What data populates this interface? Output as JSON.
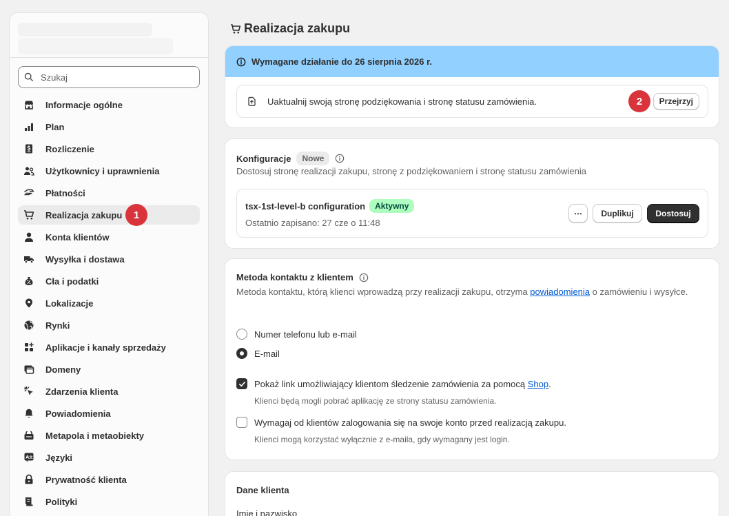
{
  "sidebar": {
    "search_placeholder": "Szukaj",
    "items": [
      {
        "label": "Informacje ogólne",
        "icon": "store-icon"
      },
      {
        "label": "Plan",
        "icon": "plan-icon"
      },
      {
        "label": "Rozliczenie",
        "icon": "billing-icon"
      },
      {
        "label": "Użytkownicy i uprawnienia",
        "icon": "users-icon"
      },
      {
        "label": "Płatności",
        "icon": "payments-icon"
      },
      {
        "label": "Realizacja zakupu",
        "icon": "cart-icon",
        "active": true,
        "marker": "1"
      },
      {
        "label": "Konta klientów",
        "icon": "person-icon"
      },
      {
        "label": "Wysyłka i dostawa",
        "icon": "truck-icon"
      },
      {
        "label": "Cła i podatki",
        "icon": "tax-icon"
      },
      {
        "label": "Lokalizacje",
        "icon": "location-icon"
      },
      {
        "label": "Rynki",
        "icon": "globe-icon"
      },
      {
        "label": "Aplikacje i kanały sprzedaży",
        "icon": "apps-icon"
      },
      {
        "label": "Domeny",
        "icon": "domain-icon"
      },
      {
        "label": "Zdarzenia klienta",
        "icon": "cursor-icon"
      },
      {
        "label": "Powiadomienia",
        "icon": "bell-icon"
      },
      {
        "label": "Metapola i metaobiekty",
        "icon": "metafields-icon"
      },
      {
        "label": "Języki",
        "icon": "language-icon"
      },
      {
        "label": "Prywatność klienta",
        "icon": "lock-icon"
      },
      {
        "label": "Polityki",
        "icon": "policy-icon"
      }
    ]
  },
  "page": {
    "title": "Realizacja zakupu"
  },
  "banner": {
    "text": "Wymagane działanie do 26 sierpnia 2026 r.",
    "update_text": "Uaktualnij swoją stronę podziękowania i stronę statusu zamówienia.",
    "review_label": "Przejrzyj",
    "marker": "2"
  },
  "configs": {
    "title": "Konfiguracje",
    "badge": "Nowe",
    "subtitle": "Dostosuj stronę realizacji zakupu, stronę z podziękowaniem i stronę statusu zamówienia",
    "item_name": "tsx-1st-level-b configuration",
    "item_status": "Aktywny",
    "item_saved": "Ostatnio zapisano: 27 cze o 11:48",
    "more_label": "⋯",
    "duplicate_label": "Duplikuj",
    "customize_label": "Dostosuj"
  },
  "contact": {
    "title": "Metoda kontaktu z klientem",
    "desc_before": "Metoda kontaktu, którą klienci wprowadzą przy realizacji zakupu, otrzyma ",
    "desc_link": "powiadomienia",
    "desc_after": " o zamówieniu i wysyłce.",
    "option_phone": "Numer telefonu lub e-mail",
    "option_email": "E-mail",
    "selected": "E-mail",
    "chk1_before": "Pokaż link umożliwiający klientom śledzenie zamówienia za pomocą ",
    "chk1_link": "Shop",
    "chk1_after": ".",
    "chk1_help": "Klienci będą mogli pobrać aplikację ze strony statusu zamówienia.",
    "chk1_checked": true,
    "chk2_label": "Wymagaj od klientów zalogowania się na swoje konto przed realizacją zakupu.",
    "chk2_help": "Klienci mogą korzystać wyłącznie z e-maila, gdy wymagany jest login.",
    "chk2_checked": false
  },
  "customer": {
    "title": "Dane klienta",
    "field": "Imię i nazwisko"
  }
}
